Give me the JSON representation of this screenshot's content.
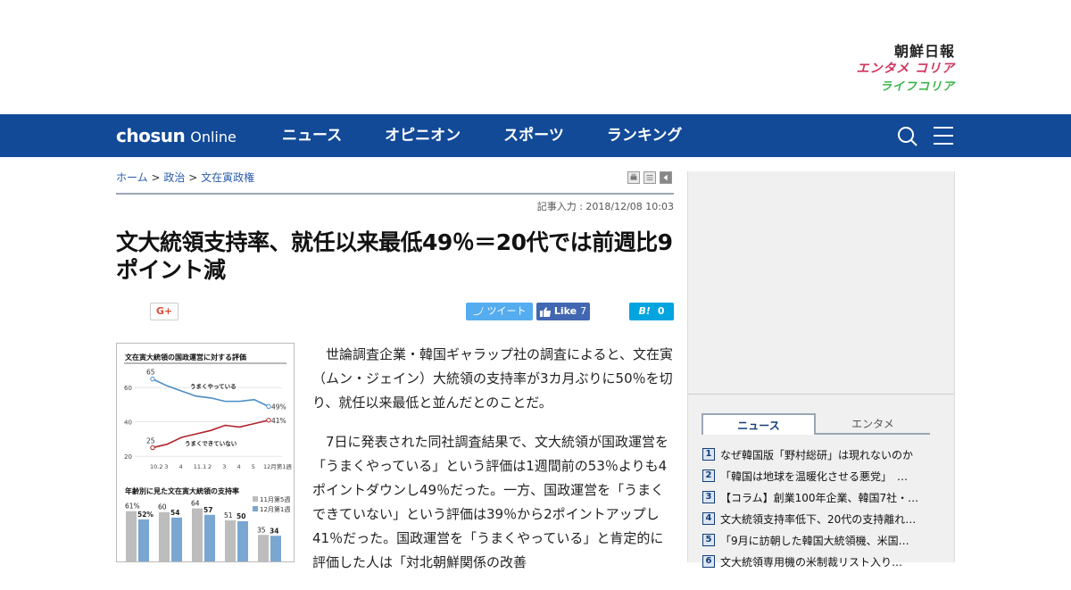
{
  "brand": {
    "main": "朝鮮日報",
    "entame": "エンタメ コリア",
    "life": "ライフコリア"
  },
  "nav": {
    "logo_bold": "chosun",
    "logo_thin": "Online",
    "items": [
      "ニュース",
      "オピニオン",
      "スポーツ",
      "ランキング"
    ],
    "icons": [
      "search-icon",
      "hamburger-menu-icon"
    ]
  },
  "breadcrumb": {
    "home": "ホーム",
    "section": "政治",
    "subsection": "文在寅政権",
    "sep": ">"
  },
  "article": {
    "date": "記事入力 : 2018/12/08 10:03",
    "headline": "文大統領支持率、就任以来最低49％＝20代では前週比9ポイント減",
    "paragraphs": [
      "世論調査企業・韓国ギャラップ社の調査によると、文在寅（ムン・ジェイン）大統領の支持率が3カ月ぶりに50％を切り、就任以来最低と並んだとのことだ。",
      "7日に発表された同社調査結果で、文大統領が国政運営を「うまくやっている」という評価は1週間前の53％よりも4ポイントダウンし49％だった。一方、国政運営を「うまくできていない」という評価は39％から2ポイントアップし41％だった。国政運営を「うまくやっている」と肯定的に評価した人は「対北朝鮮関係の改善"
    ]
  },
  "share": {
    "gplus": "G+",
    "tweet": "ツイート",
    "like": "Like",
    "like_count": "7",
    "hatena_count": "0"
  },
  "figure": {
    "title1": "文在寅大統領の国政運営に対する評価",
    "line1_label": "うまくやっている",
    "line2_label": "うまくできていない",
    "y_ticks": [
      "60",
      "40",
      "20"
    ],
    "x_ticks": [
      "10.2",
      "3",
      "4",
      "11.1",
      "2",
      "3",
      "4",
      "5",
      "12月第1週"
    ],
    "line1_start": "65",
    "line1_end": "49%",
    "line2_start": "25",
    "line2_end": "41%",
    "title2": "年齢別に見た文在寅大統領の支持率",
    "legend1": "11月第5週",
    "legend2": "12月第1週",
    "bar_labels": [
      {
        "a": "61%",
        "b": "52%"
      },
      {
        "a": "60",
        "b": "54"
      },
      {
        "a": "64",
        "b": "57"
      },
      {
        "a": "51",
        "b": "50"
      },
      {
        "a": "35",
        "b": "34"
      }
    ]
  },
  "chart_data": [
    {
      "type": "line",
      "title": "文在寅大統領の国政運営に対する評価",
      "categories": [
        "10.2",
        "3",
        "4",
        "11.1",
        "2",
        "3",
        "4",
        "5",
        "12月第1週"
      ],
      "series": [
        {
          "name": "うまくやっている",
          "values": [
            65,
            61,
            58,
            55,
            54,
            52,
            52,
            53,
            49
          ]
        },
        {
          "name": "うまくできていない",
          "values": [
            25,
            27,
            31,
            33,
            35,
            38,
            37,
            39,
            41
          ]
        }
      ],
      "ylim": [
        18,
        70
      ]
    },
    {
      "type": "bar",
      "title": "年齢別に見た文在寅大統領の支持率",
      "categories": [
        "",
        "",
        "",
        "",
        ""
      ],
      "series": [
        {
          "name": "11月第5週",
          "values": [
            61,
            60,
            64,
            51,
            35
          ]
        },
        {
          "name": "12月第1週",
          "values": [
            52,
            54,
            57,
            50,
            34
          ]
        }
      ],
      "ylim": [
        0,
        70
      ]
    }
  ],
  "sidebar": {
    "tabs": [
      "ニュース",
      "エンタメ"
    ],
    "ranking": [
      {
        "no": "1",
        "text": "なぜ韓国版「野村総研」は現れないのか"
      },
      {
        "no": "2",
        "text": "「韓国は地球を温暖化させる悪党」　…"
      },
      {
        "no": "3",
        "text": "【コラム】創業100年企業、韓国7社・…"
      },
      {
        "no": "4",
        "text": "文大統領支持率低下、20代の支持離れ…"
      },
      {
        "no": "5",
        "text": "「9月に訪朝した韓国大統領機、米国…"
      },
      {
        "no": "6",
        "text": "文大統領専用機の米制裁リスト入り…"
      }
    ]
  },
  "colors": {
    "nav_bg": "#124a98",
    "line_positive": "#4a8cc7",
    "line_negative": "#b0242b",
    "bar_a": "#bdbdbd",
    "bar_b": "#7aa7d1"
  }
}
